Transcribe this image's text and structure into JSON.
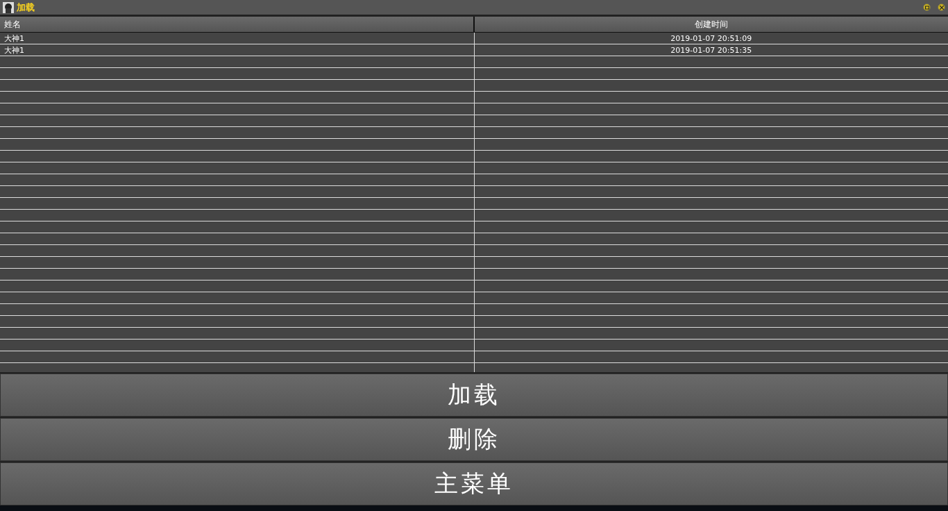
{
  "window": {
    "title": "加载"
  },
  "table": {
    "columns": [
      "姓名",
      "创建时间"
    ],
    "rows": [
      {
        "cells": [
          "大神1",
          "2019-01-07 20:51:09"
        ]
      },
      {
        "cells": [
          "大神1",
          "2019-01-07 20:51:35"
        ]
      }
    ]
  },
  "buttons": [
    "加载",
    "删除",
    "主菜单"
  ]
}
